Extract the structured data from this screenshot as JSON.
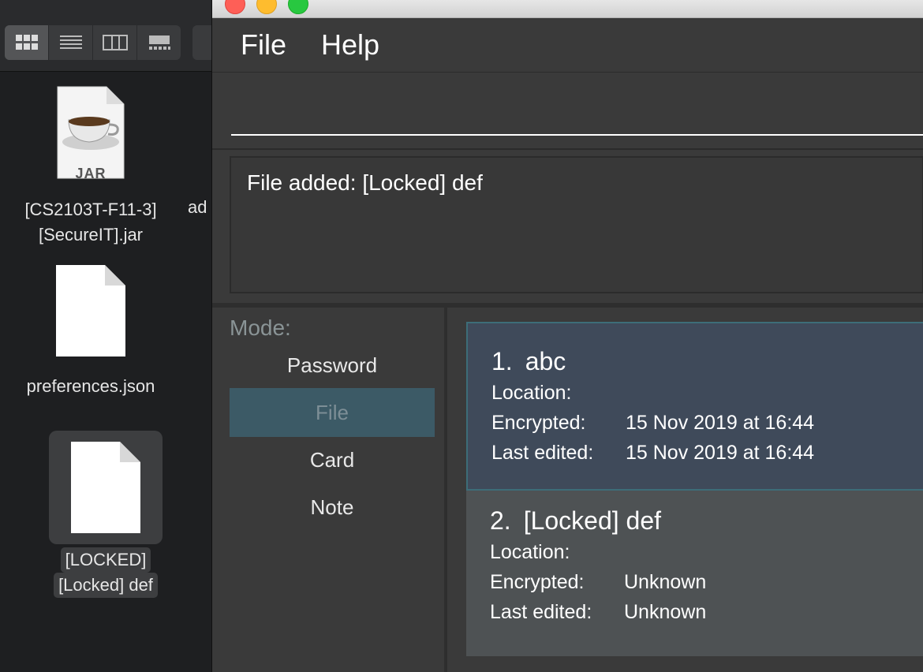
{
  "finder": {
    "files": [
      {
        "name_line1": "[CS2103T-F11-3]",
        "name_line2": "[SecureIT].jar",
        "badge": "JAR",
        "icon": "jar-file-icon"
      },
      {
        "name_line1": "preferences.json",
        "icon": "document-icon"
      },
      {
        "name_line1": "[LOCKED]",
        "name_line2": "[Locked] def",
        "icon": "document-icon",
        "selected": true
      }
    ],
    "cut_label": "ad"
  },
  "app": {
    "menu": {
      "file": "File",
      "help": "Help"
    },
    "command": {
      "value": "",
      "placeholder": ""
    },
    "result": "File added: [Locked] def",
    "mode": {
      "title": "Mode:",
      "items": [
        "Password",
        "File",
        "Card",
        "Note"
      ],
      "active": "File"
    },
    "files": [
      {
        "index": "1.",
        "name": "abc",
        "location_label": "Location:",
        "location": "",
        "encrypted_label": "Encrypted:",
        "encrypted": "15 Nov 2019 at 16:44",
        "edited_label": "Last edited:",
        "edited": "15 Nov 2019 at 16:44"
      },
      {
        "index": "2.",
        "name": "[Locked] def",
        "location_label": "Location:",
        "location": "",
        "encrypted_label": "Encrypted:",
        "encrypted": "Unknown",
        "edited_label": "Last edited:",
        "edited": "Unknown"
      }
    ]
  },
  "colors": {
    "background": "#3a3a3a",
    "selected_card": "#3f4a5a",
    "card": "#4e5254",
    "mode_active": "#3c5a66",
    "close": "#fe5f57",
    "minimize": "#febc2e",
    "zoom": "#28c840"
  }
}
